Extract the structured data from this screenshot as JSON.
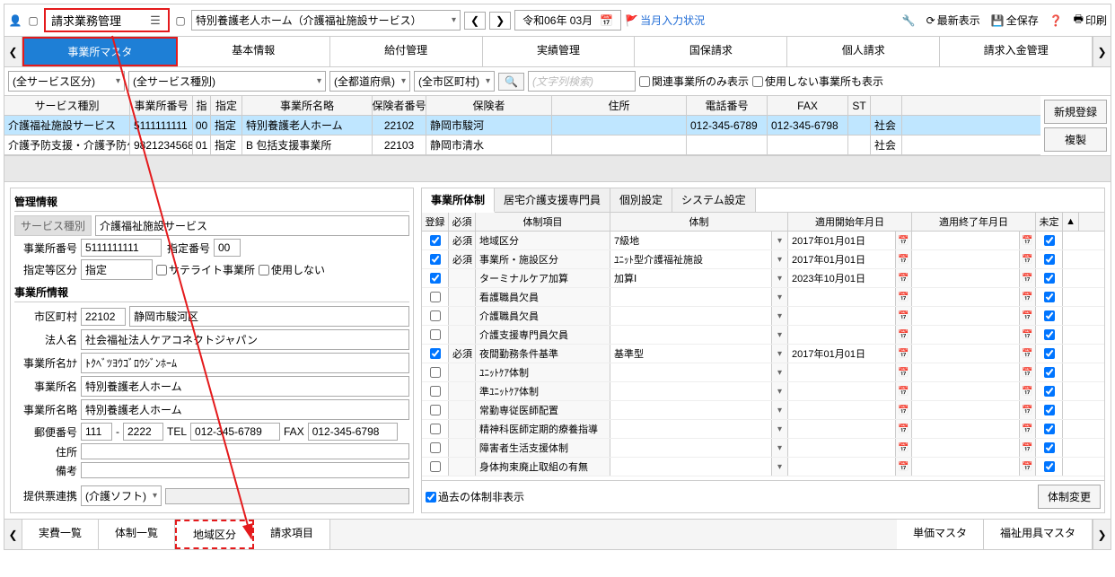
{
  "header": {
    "title": "請求業務管理",
    "facility": "特別養護老人ホーム（介護福祉施設サービス）",
    "era_date": "令和06年 03月",
    "status_link": "当月入力状況",
    "actions": {
      "refresh": "最新表示",
      "save": "全保存",
      "print": "印刷"
    }
  },
  "main_tabs": [
    "事業所マスタ",
    "基本情報",
    "給付管理",
    "実績管理",
    "国保請求",
    "個人請求",
    "請求入金管理"
  ],
  "filters": {
    "service_division": "(全サービス区分)",
    "service_type": "(全サービス種別)",
    "prefecture": "(全都道府県)",
    "city": "(全市区町村)",
    "search_placeholder": "(文字列検索)",
    "related_only": "関連事業所のみ表示",
    "show_unused": "使用しない事業所も表示"
  },
  "grid": {
    "headers": [
      "サービス種別",
      "事業所番号",
      "指",
      "指定",
      "事業所名略",
      "保険者番号",
      "保険者",
      "住所",
      "電話番号",
      "FAX",
      "ST",
      ""
    ],
    "rows": [
      {
        "vals": [
          "介護福祉施設サービス",
          "5111111111",
          "00",
          "指定",
          "特別養護老人ホーム",
          "22102",
          "静岡市駿河",
          "",
          "012-345-6789",
          "012-345-6798",
          "",
          "社会"
        ],
        "selected": true
      },
      {
        "vals": [
          "介護予防支援・介護予防ケ",
          "9821234568",
          "01",
          "指定",
          "B 包括支援事業所",
          "22103",
          "静岡市清水",
          "",
          "",
          "",
          "",
          "社会"
        ],
        "selected": false
      }
    ]
  },
  "side_buttons": {
    "new": "新規登録",
    "copy": "複製"
  },
  "mgmt": {
    "title": "管理情報",
    "service_type_label": "サービス種別",
    "service_type": "介護福祉施設サービス",
    "office_no_label": "事業所番号",
    "office_no": "5111111111",
    "designation_no_label": "指定番号",
    "designation_no": "00",
    "designation_class_label": "指定等区分",
    "designation_class": "指定",
    "satellite": "サテライト事業所",
    "unused": "使用しない",
    "office_info_title": "事業所情報",
    "city_code_label": "市区町村",
    "city_code": "22102",
    "city_name": "静岡市駿河区",
    "corp_label": "法人名",
    "corp": "社会福祉法人ケアコネクトジャパン",
    "office_kana_label": "事業所名ｶﾅ",
    "office_kana": "ﾄｸﾍﾞﾂﾖｳｺﾞﾛｳｼﾞﾝﾎｰﾑ",
    "office_name_label": "事業所名",
    "office_name": "特別養護老人ホーム",
    "office_short_label": "事業所名略",
    "office_short": "特別養護老人ホーム",
    "postal_label": "郵便番号",
    "postal1": "111",
    "postal2": "2222",
    "tel_label": "TEL",
    "tel": "012-345-6789",
    "fax_label": "FAX",
    "fax": "012-345-6798",
    "address_label": "住所",
    "remarks_label": "備考",
    "provision_link_label": "提供票連携",
    "provision_link": "(介護ソフト)"
  },
  "detail": {
    "tabs": [
      "事業所体制",
      "居宅介護支援専門員",
      "個別設定",
      "システム設定"
    ],
    "headers": {
      "reg": "登録",
      "req": "必須",
      "item": "体制項目",
      "system": "体制",
      "start": "適用開始年月日",
      "end": "適用終了年月日",
      "undef": "未定"
    },
    "rows": [
      {
        "reg": true,
        "req": "必須",
        "item": "地域区分",
        "system": "7級地",
        "start": "2017年01月01日",
        "undef": true
      },
      {
        "reg": true,
        "req": "必須",
        "item": "事業所・施設区分",
        "system": "ﾕﾆｯﾄ型介護福祉施設",
        "start": "2017年01月01日",
        "undef": true
      },
      {
        "reg": true,
        "req": "",
        "item": "ターミナルケア加算",
        "system": "加算Ⅰ",
        "start": "2023年10月01日",
        "undef": true
      },
      {
        "reg": false,
        "req": "",
        "item": "看護職員欠員",
        "system": "",
        "start": "",
        "undef": true
      },
      {
        "reg": false,
        "req": "",
        "item": "介護職員欠員",
        "system": "",
        "start": "",
        "undef": true
      },
      {
        "reg": false,
        "req": "",
        "item": "介護支援専門員欠員",
        "system": "",
        "start": "",
        "undef": true
      },
      {
        "reg": true,
        "req": "必須",
        "item": "夜間勤務条件基準",
        "system": "基準型",
        "start": "2017年01月01日",
        "undef": true
      },
      {
        "reg": false,
        "req": "",
        "item": "ﾕﾆｯﾄｹｱ体制",
        "system": "",
        "start": "",
        "undef": true
      },
      {
        "reg": false,
        "req": "",
        "item": "準ﾕﾆｯﾄｹｱ体制",
        "system": "",
        "start": "",
        "undef": true
      },
      {
        "reg": false,
        "req": "",
        "item": "常勤専従医師配置",
        "system": "",
        "start": "",
        "undef": true
      },
      {
        "reg": false,
        "req": "",
        "item": "精神科医師定期的療養指導",
        "system": "",
        "start": "",
        "undef": true
      },
      {
        "reg": false,
        "req": "",
        "item": "障害者生活支援体制",
        "system": "",
        "start": "",
        "undef": true
      },
      {
        "reg": false,
        "req": "",
        "item": "身体拘束廃止取組の有無",
        "system": "",
        "start": "",
        "undef": true
      }
    ],
    "hide_past": "過去の体制非表示",
    "change_btn": "体制変更"
  },
  "bottom_tabs": {
    "left": [
      "実費一覧",
      "体制一覧",
      "地域区分",
      "請求項目"
    ],
    "right": [
      "単価マスタ",
      "福祉用具マスタ"
    ]
  }
}
